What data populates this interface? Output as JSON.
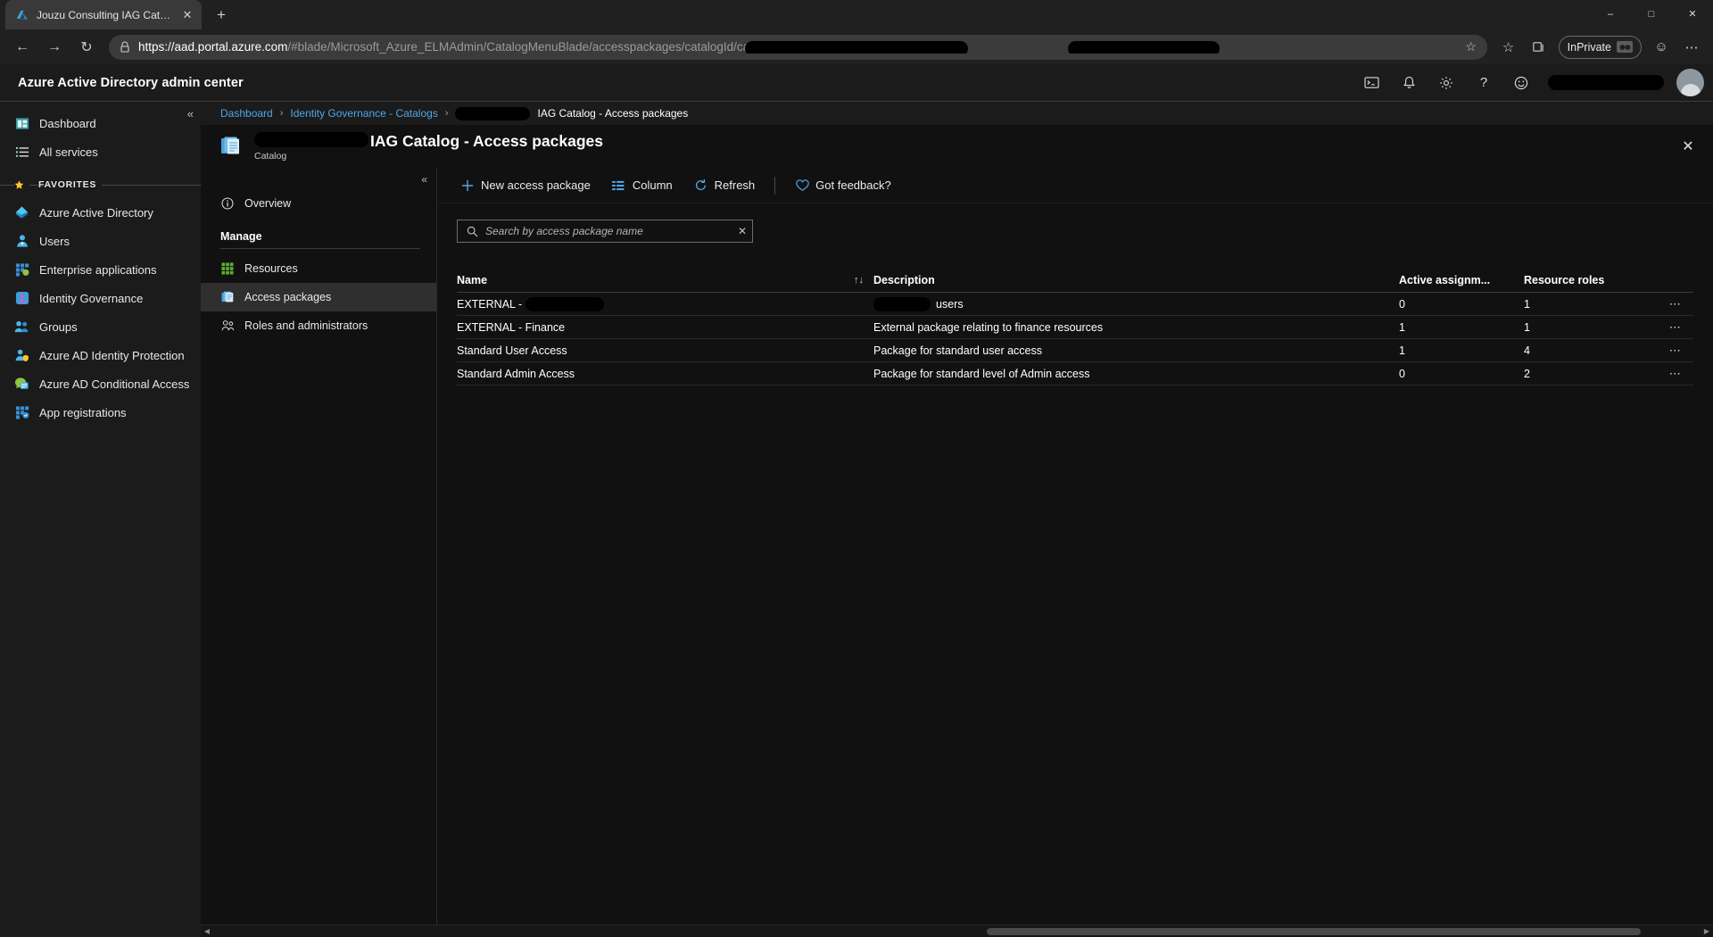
{
  "browser": {
    "tab": {
      "title": "Jouzu Consulting IAG Catalog - A",
      "favicon": "azure-logo-icon",
      "close": "✕"
    },
    "newtab_label": "+",
    "window_controls": {
      "minimize": "–",
      "maximize": "□",
      "close": "✕"
    },
    "nav": {
      "back": "←",
      "forward": "→",
      "reload": "↻"
    },
    "omnibox": {
      "scheme": "https",
      "host": "://aad.portal.azure.com",
      "path": "/#blade/Microsoft_Azure_ELMAdmin/CatalogMenuBlade/accesspackages/catalogId/",
      "path_tail": "catalogName,",
      "star": "☆"
    },
    "toolbar": {
      "favorites_icon": "☆",
      "collections_label": "collections-icon",
      "inprivate_label": "InPrivate",
      "smiley": "☺",
      "settings_more": "⋯"
    }
  },
  "azure_header": {
    "title": "Azure Active Directory admin center",
    "icons": [
      "cloud-shell-icon",
      "notifications-icon",
      "settings-gear-icon",
      "help-icon",
      "feedback-smiley-icon"
    ]
  },
  "portal_nav": {
    "collapse": "«",
    "items": [
      {
        "label": "Dashboard",
        "icon": "dashboard-icon"
      },
      {
        "label": "All services",
        "icon": "all-services-icon"
      }
    ],
    "favorites_label": "FAVORITES",
    "favorites": [
      {
        "label": "Azure Active Directory",
        "icon": "azure-ad-icon"
      },
      {
        "label": "Users",
        "icon": "users-icon"
      },
      {
        "label": "Enterprise applications",
        "icon": "enterprise-apps-icon"
      },
      {
        "label": "Identity Governance",
        "icon": "identity-governance-icon"
      },
      {
        "label": "Groups",
        "icon": "groups-icon"
      },
      {
        "label": "Azure AD Identity Protection",
        "icon": "identity-protection-icon"
      },
      {
        "label": "Azure AD Conditional Access",
        "icon": "conditional-access-icon"
      },
      {
        "label": "App registrations",
        "icon": "app-registrations-icon"
      }
    ]
  },
  "breadcrumb": {
    "items": [
      {
        "label": "Dashboard",
        "type": "link"
      },
      {
        "label": "Identity Governance - Catalogs",
        "type": "link"
      },
      {
        "label": "",
        "type": "redacted"
      },
      {
        "label": "IAG Catalog - Access packages",
        "type": "current"
      }
    ],
    "separator": "›"
  },
  "blade": {
    "icon": "catalog-icon",
    "subtitle": "Catalog",
    "title": "IAG Catalog - Access packages",
    "close": "✕",
    "menu": {
      "collapse": "«",
      "overview": {
        "label": "Overview",
        "icon": "info-circle-icon"
      },
      "section_manage": "Manage",
      "items": [
        {
          "label": "Resources",
          "icon": "resources-grid-icon",
          "selected": false
        },
        {
          "label": "Access packages",
          "icon": "access-packages-icon",
          "selected": true
        },
        {
          "label": "Roles and administrators",
          "icon": "roles-admins-icon",
          "selected": false
        }
      ]
    },
    "commandbar": [
      {
        "label": "New access package",
        "icon": "plus-icon"
      },
      {
        "label": "Column",
        "icon": "columns-icon"
      },
      {
        "label": "Refresh",
        "icon": "refresh-icon"
      },
      {
        "label": "Got feedback?",
        "icon": "heart-icon"
      }
    ],
    "search": {
      "placeholder": "Search by access package name",
      "value": "",
      "icon": "search-icon",
      "clear": "✕"
    },
    "table": {
      "sort_indicator": "↑↓",
      "columns": [
        "Name",
        "Description",
        "Active assignm...",
        "Resource roles"
      ],
      "rows": [
        {
          "name_prefix": "EXTERNAL -",
          "name_redacted": true,
          "description_prefix": "",
          "description_redacted": true,
          "description_suffix": "users",
          "active": "0",
          "roles": "1",
          "more": "⋯"
        },
        {
          "name_prefix": "EXTERNAL - Finance",
          "name_redacted": false,
          "description_prefix": "External package relating to finance resources",
          "description_redacted": false,
          "description_suffix": "",
          "active": "1",
          "roles": "1",
          "more": "⋯"
        },
        {
          "name_prefix": "Standard User Access",
          "name_redacted": false,
          "description_prefix": "Package for standard user access",
          "description_redacted": false,
          "description_suffix": "",
          "active": "1",
          "roles": "4",
          "more": "⋯"
        },
        {
          "name_prefix": "Standard Admin Access",
          "name_redacted": false,
          "description_prefix": "Package for standard level of Admin access",
          "description_redacted": false,
          "description_suffix": "",
          "active": "0",
          "roles": "2",
          "more": "⋯"
        }
      ]
    }
  },
  "scrollbar": {
    "left_arrow": "◀",
    "right_arrow": "▶"
  },
  "colors": {
    "accent": "#4ea6ea",
    "selected_row": "#2f2f2f",
    "bg": "#111111",
    "chrome": "#202020"
  }
}
